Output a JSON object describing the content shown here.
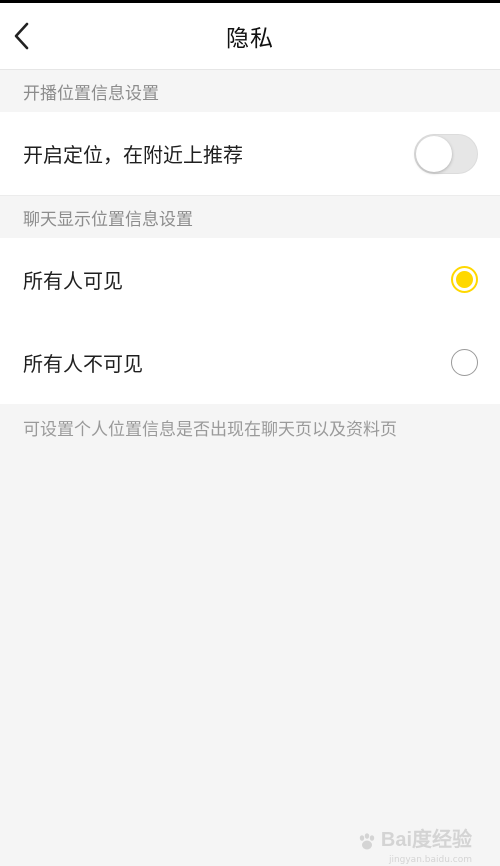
{
  "header": {
    "title": "隐私"
  },
  "sections": {
    "broadcast_location": {
      "title": "开播位置信息设置",
      "toggle_label": "开启定位，在附近上推荐",
      "toggle_on": false
    },
    "chat_location": {
      "title": "聊天显示位置信息设置",
      "options": [
        {
          "label": "所有人可见",
          "selected": true
        },
        {
          "label": "所有人不可见",
          "selected": false
        }
      ],
      "note": "可设置个人位置信息是否出现在聊天页以及资料页"
    }
  },
  "watermark": {
    "text": "Bai度经验",
    "sub": "jingyan.baidu.com"
  },
  "colors": {
    "accent": "#ffd800",
    "background": "#f5f5f5",
    "section_text": "#8c8c8c"
  },
  "icons": {
    "back": "chevron-left-icon",
    "watermark_paw": "paw-icon"
  }
}
